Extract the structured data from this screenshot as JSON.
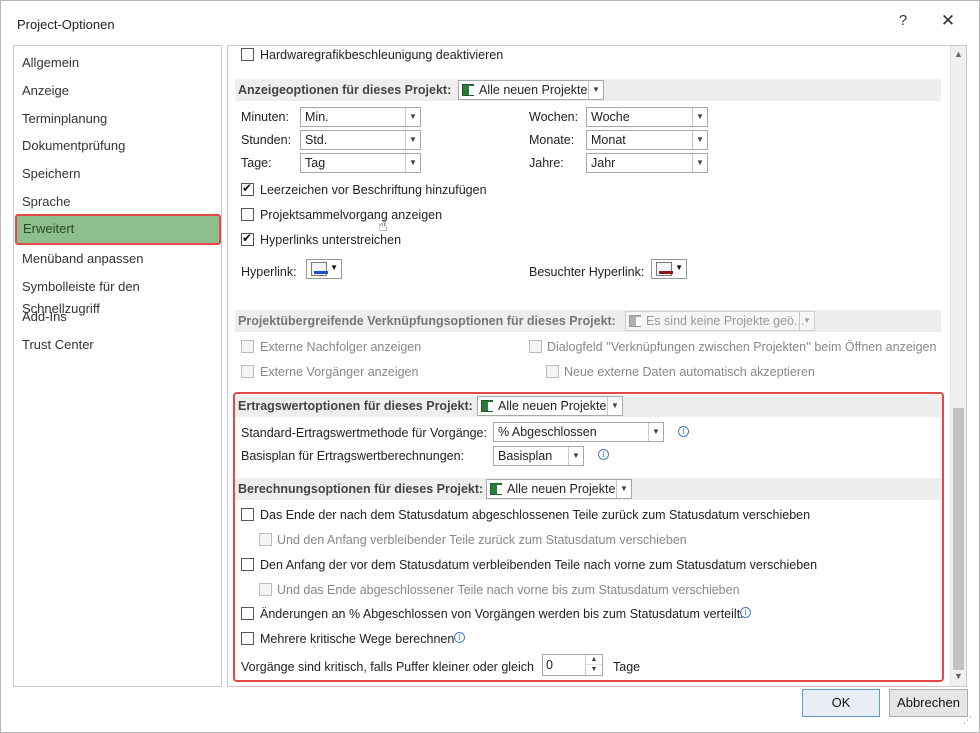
{
  "window": {
    "title": "Project-Optionen",
    "help_label": "?",
    "close_label": "✕"
  },
  "nav": {
    "items": [
      "Allgemein",
      "Anzeige",
      "Terminplanung",
      "Dokumentprüfung",
      "Speichern",
      "Sprache",
      "Erweitert",
      "Menüband anpassen",
      "Symbolleiste für den Schnellzugriff",
      "Add-Ins",
      "Trust Center"
    ],
    "selected": "Erweitert"
  },
  "top": {
    "hw_accel_label": "Hardwaregrafikbeschleunigung deaktivieren"
  },
  "display": {
    "section_label": "Anzeigeoptionen für dieses Projekt:",
    "project_select": "Alle neuen Projekte",
    "minutes_label": "Minuten:",
    "minutes_value": "Min.",
    "hours_label": "Stunden:",
    "hours_value": "Std.",
    "days_label": "Tage:",
    "days_value": "Tag",
    "weeks_label": "Wochen:",
    "weeks_value": "Woche",
    "months_label": "Monate:",
    "months_value": "Monat",
    "years_label": "Jahre:",
    "years_value": "Jahr",
    "add_space_label": "Leerzeichen vor Beschriftung hinzufügen",
    "summary_task_label": "Projektsammelvorgang anzeigen",
    "underline_links_label": "Hyperlinks unterstreichen",
    "hyperlink_label": "Hyperlink:",
    "visited_hyperlink_label": "Besuchter Hyperlink:",
    "hyperlink_color": "#1f4fd1",
    "visited_color": "#8b1a1a"
  },
  "crossproject": {
    "section_label": "Projektübergreifende Verknüpfungsoptionen für dieses Projekt:",
    "project_select": "Es sind keine Projekte geö...",
    "ext_successors_label": "Externe Nachfolger anzeigen",
    "ext_predecessors_label": "Externe Vorgänger anzeigen",
    "links_dialog_label": "Dialogfeld ''Verknüpfungen zwischen Projekten'' beim Öffnen anzeigen",
    "auto_accept_label": "Neue externe Daten automatisch akzeptieren"
  },
  "earned_value": {
    "section_label": "Ertragswertoptionen für dieses Projekt:",
    "project_select": "Alle neuen Projekte",
    "method_label": "Standard-Ertragswertmethode für Vorgänge:",
    "method_value": "% Abgeschlossen",
    "baseline_label": "Basisplan für Ertragswertberechnungen:",
    "baseline_value": "Basisplan"
  },
  "calculation": {
    "section_label": "Berechnungsoptionen für dieses Projekt:",
    "project_select": "Alle neuen Projekte",
    "move_end_label": "Das Ende der nach dem Statusdatum abgeschlossenen Teile zurück zum Statusdatum verschieben",
    "move_start_remaining_label": "Und den Anfang verbleibender Teile zurück zum Statusdatum verschieben",
    "move_start_label": "Den Anfang der vor dem Statusdatum verbleibenden Teile nach vorne zum Statusdatum verschieben",
    "move_end_completed_label": "Und das Ende abgeschlossener Teile nach vorne bis zum Statusdatum verschieben",
    "spread_label": "Änderungen an % Abgeschlossen von Vorgängen werden bis zum Statusdatum verteilt.",
    "multiple_critical_label": "Mehrere kritische Wege berechnen",
    "critical_slack_label": "Vorgänge sind kritisch, falls Puffer kleiner oder gleich",
    "critical_slack_value": "0",
    "critical_slack_unit": "Tage"
  },
  "buttons": {
    "ok": "OK",
    "cancel": "Abbrechen"
  }
}
